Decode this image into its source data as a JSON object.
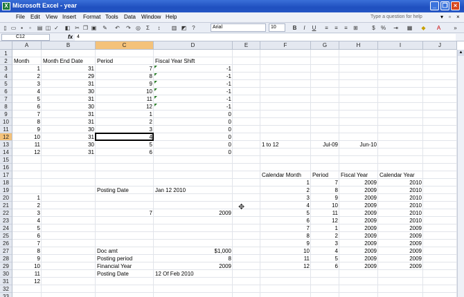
{
  "window": {
    "app_letter": "X",
    "title": "Microsoft Excel - year",
    "minimize": "_",
    "restore": "❐",
    "close": "×"
  },
  "menu": {
    "items": [
      "File",
      "Edit",
      "View",
      "Insert",
      "Format",
      "Tools",
      "Data",
      "Window",
      "Help"
    ],
    "help_placeholder": "Type a question for help"
  },
  "toolbar": {
    "font_name": "Arial",
    "font_size": "10",
    "bold": "B",
    "italic": "I",
    "underline": "U",
    "currency": "$",
    "percent": "%"
  },
  "formula_bar": {
    "name_box": "C12",
    "fx": "fx",
    "content": "4"
  },
  "columns": [
    "A",
    "B",
    "C",
    "D",
    "E",
    "F",
    "G",
    "H",
    "I",
    "J"
  ],
  "selected_column": "C",
  "rows": [
    "1",
    "2",
    "3",
    "4",
    "5",
    "6",
    "7",
    "8",
    "9",
    "10",
    "11",
    "12",
    "13",
    "14",
    "15",
    "16",
    "17",
    "18",
    "19",
    "20",
    "21",
    "22",
    "23",
    "24",
    "25",
    "26",
    "27",
    "28",
    "29",
    "30",
    "31",
    "32",
    "33"
  ],
  "selected_row": "12",
  "cells": {
    "A2": "Month",
    "B2": "Month End Date",
    "C2": "Period",
    "D2": "Fiscal Year Shift",
    "A3": "1",
    "B3": "31",
    "C3": "7",
    "D3": "-1",
    "A4": "2",
    "B4": "29",
    "C4": "8",
    "D4": "-1",
    "A5": "3",
    "B5": "31",
    "C5": "9",
    "D5": "-1",
    "A6": "4",
    "B6": "30",
    "C6": "10",
    "D6": "-1",
    "A7": "5",
    "B7": "31",
    "C7": "11",
    "D7": "-1",
    "A8": "6",
    "B8": "30",
    "C8": "12",
    "D8": "-1",
    "A9": "7",
    "B9": "31",
    "C9": "1",
    "D9": "0",
    "A10": "8",
    "B10": "31",
    "C10": "2",
    "D10": "0",
    "A11": "9",
    "B11": "30",
    "C11": "3",
    "D11": "0",
    "A12": "10",
    "B12": "31",
    "C12": "4",
    "D12": "0",
    "A13": "11",
    "B13": "30",
    "C13": "5",
    "D13": "0",
    "A14": "12",
    "B14": "31",
    "C14": "6",
    "D14": "0",
    "F13": "1 to 12",
    "G13": "Jul-09",
    "H13": "Jun-10",
    "F17": "Calendar Month",
    "G17": "Period",
    "H17": "Fiscal Year",
    "I17": "Calendar Year",
    "F18": "1",
    "G18": "7",
    "H18": "2009",
    "I18": "2010",
    "F19": "2",
    "G19": "8",
    "H19": "2009",
    "I19": "2010",
    "F20": "3",
    "G20": "9",
    "H20": "2009",
    "I20": "2010",
    "F21": "4",
    "G21": "10",
    "H21": "2009",
    "I21": "2010",
    "F22": "5",
    "G22": "11",
    "H22": "2009",
    "I22": "2010",
    "F23": "6",
    "G23": "12",
    "H23": "2009",
    "I23": "2010",
    "F24": "7",
    "G24": "1",
    "H24": "2009",
    "I24": "2009",
    "F25": "8",
    "G25": "2",
    "H25": "2009",
    "I25": "2009",
    "F26": "9",
    "G26": "3",
    "H26": "2009",
    "I26": "2009",
    "F27": "10",
    "G27": "4",
    "H27": "2009",
    "I27": "2009",
    "F28": "11",
    "G28": "5",
    "H28": "2009",
    "I28": "2009",
    "F29": "12",
    "G29": "6",
    "H29": "2009",
    "I29": "2009",
    "C19": "Posting Date",
    "D19": "Jan 12 2010",
    "A20": "1",
    "A21": "2",
    "A22": "3",
    "C22": "7",
    "D22": "2009",
    "A23": "4",
    "A24": "5",
    "A25": "6",
    "A26": "7",
    "A27": "8",
    "C27": "Doc amt",
    "D27": "$1,000",
    "A28": "9",
    "C28": "Posting period",
    "D28": "8",
    "A29": "10",
    "C29": "Financial Year",
    "D29": "2009",
    "A30": "11",
    "C30": "Posting Date",
    "D30": "12 Of Feb 2010",
    "A31": "12"
  }
}
